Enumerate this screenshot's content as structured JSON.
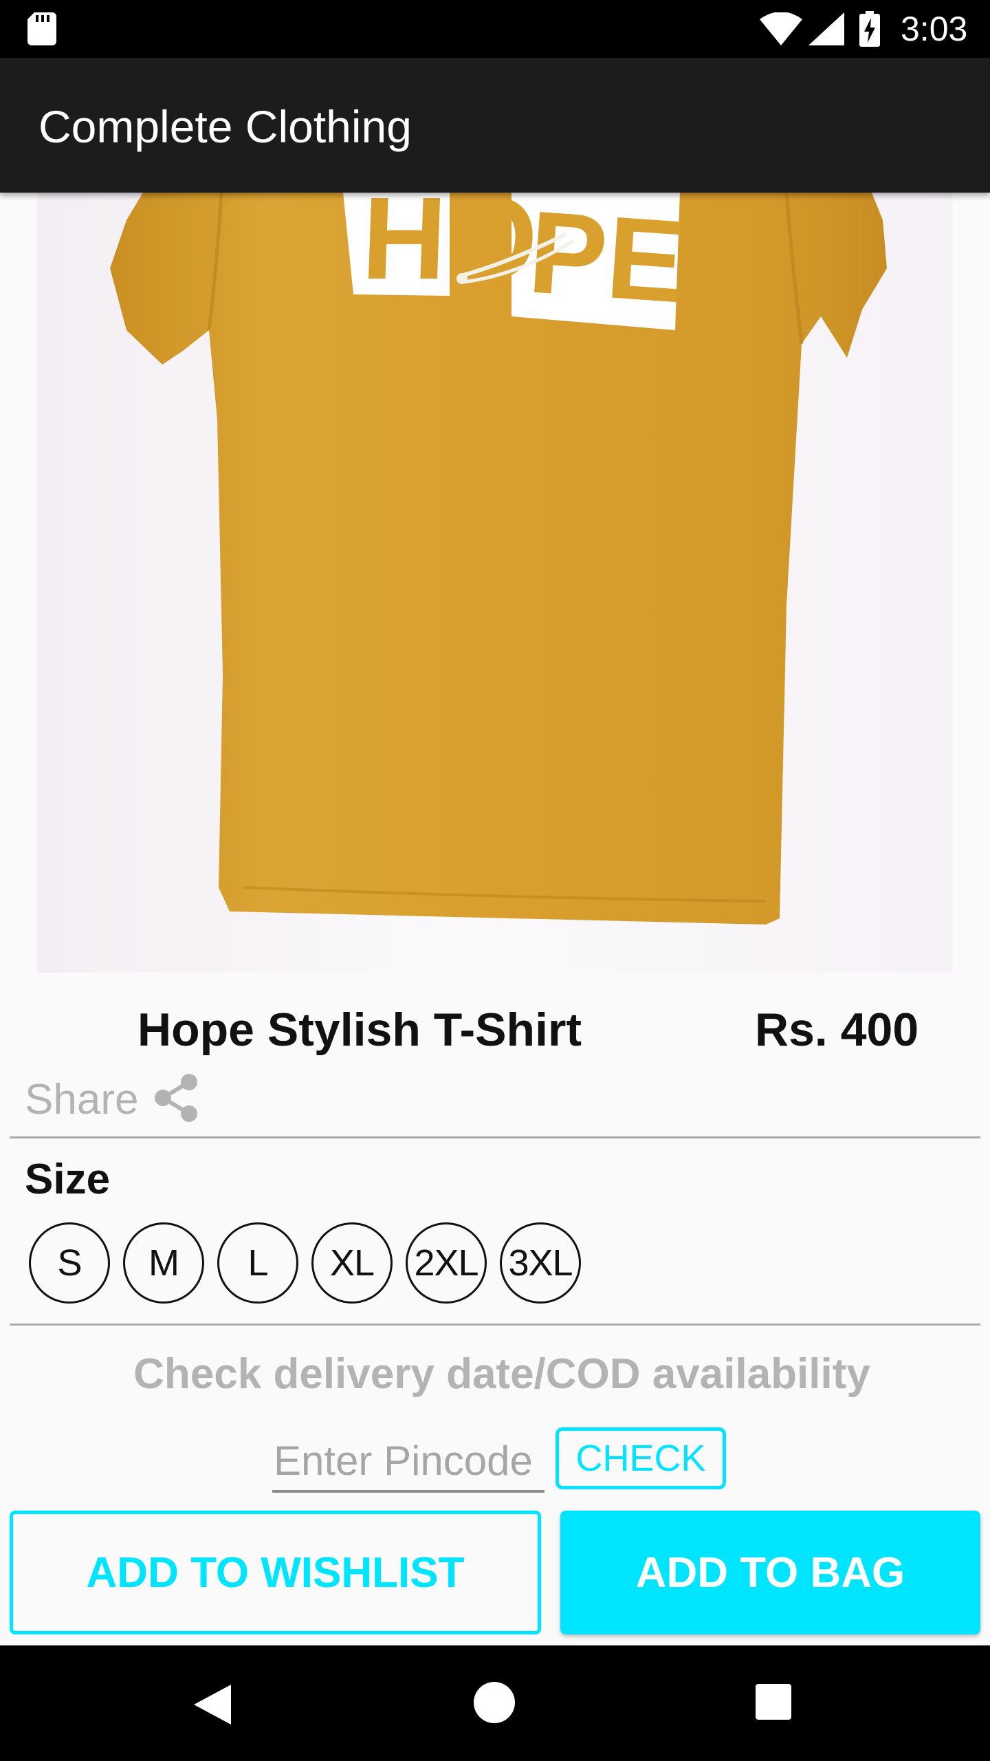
{
  "status_bar": {
    "time": "3:03"
  },
  "app_bar": {
    "title": "Complete Clothing"
  },
  "product": {
    "name": "Hope Stylish T-Shirt",
    "price": "Rs. 400",
    "image_print_text": "HOPE"
  },
  "share": {
    "label": "Share"
  },
  "size": {
    "label": "Size",
    "options": [
      "S",
      "M",
      "L",
      "XL",
      "2XL",
      "3XL"
    ]
  },
  "delivery": {
    "text": "Check delivery date/COD availability",
    "pincode_placeholder": "Enter Pincode",
    "check_label": "CHECK"
  },
  "actions": {
    "wishlist_label": "ADD TO WISHLIST",
    "bag_label": "ADD TO BAG"
  },
  "colors": {
    "accent": "#00e5ff",
    "app_bar": "#1c1c1c",
    "shirt": "#d9a02e"
  }
}
